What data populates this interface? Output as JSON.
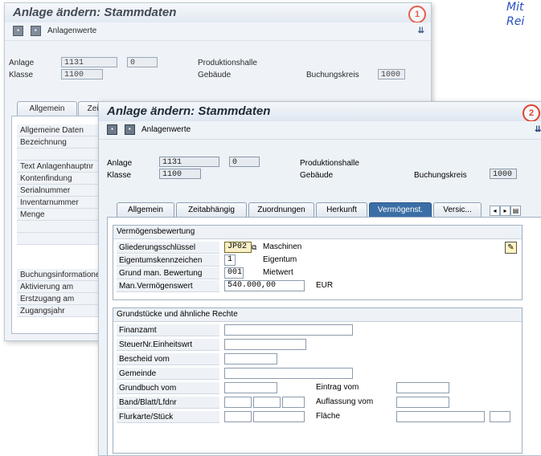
{
  "caption": {
    "line1": "Mit",
    "line2": "Rei"
  },
  "window1": {
    "title": "Anlage ändern:  Stammdaten",
    "badge": "1",
    "toolbar_label": "Anlagenwerte",
    "toolbar_end": "⇊",
    "anlage_label": "Anlage",
    "anlage_value": "1131",
    "anlage_sub": "0",
    "anlage_text": "Produktionshalle",
    "klasse_label": "Klasse",
    "klasse_value": "1100",
    "klasse_text": "Gebäude",
    "buchungskreis_label": "Buchungskreis",
    "buchungskreis_value": "1000",
    "tabs": [
      "Allgemein",
      "Zeit"
    ],
    "list": [
      "Allgemeine Daten",
      "Bezeichnung",
      "",
      "Text Anlagenhauptnr",
      "Kontenfindung",
      "Serialnummer",
      "Inventarnummer",
      "Menge",
      "",
      "",
      "Buchungsinformatione",
      "Aktivierung am",
      "Erstzugang am",
      "Zugangsjahr"
    ]
  },
  "window2": {
    "title": "Anlage ändern:  Stammdaten",
    "badge": "2",
    "toolbar_label": "Anlagenwerte",
    "toolbar_end": "⇊",
    "anlage_label": "Anlage",
    "anlage_value": "1131",
    "anlage_sub": "0",
    "anlage_text": "Produktionshalle",
    "klasse_label": "Klasse",
    "klasse_value": "1100",
    "klasse_text": "Gebäude",
    "buchungskreis_label": "Buchungskreis",
    "buchungskreis_value": "1000",
    "tabs": [
      "Allgemein",
      "Zeitabhängig",
      "Zuordnungen",
      "Herkunft",
      "Vermögenst.",
      "Versic..."
    ],
    "active_tab": "Vermögenst.",
    "group1": {
      "title": "Vermögensbewertung",
      "rows": [
        {
          "label": "Gliederungsschlüssel",
          "value": "JP02",
          "text": "Maschinen"
        },
        {
          "label": "Eigentumskennzeichen",
          "value": "1",
          "text": "Eigentum"
        },
        {
          "label": "Grund man. Bewertung",
          "value": "001",
          "text": "Mietwert"
        },
        {
          "label": "Man.Vermögenswert",
          "value": "540.000,00",
          "text": "EUR"
        }
      ]
    },
    "group2": {
      "title": "Grundstücke und ähnliche Rechte",
      "finanzamt": "Finanzamt",
      "steuernr": "SteuerNr.Einheitswrt",
      "bescheid": "Bescheid vom",
      "gemeinde": "Gemeinde",
      "grundbuch": "Grundbuch vom",
      "eintrag": "Eintrag vom",
      "band": "Band/Blatt/Lfdnr",
      "auflassung": "Auflassung vom",
      "flurkarte": "Flurkarte/Stück",
      "flaeche": "Fläche"
    }
  },
  "colors": {
    "accent_tab": "#3b6ea5",
    "badge": "#e0422e",
    "caption": "#2850c0"
  }
}
